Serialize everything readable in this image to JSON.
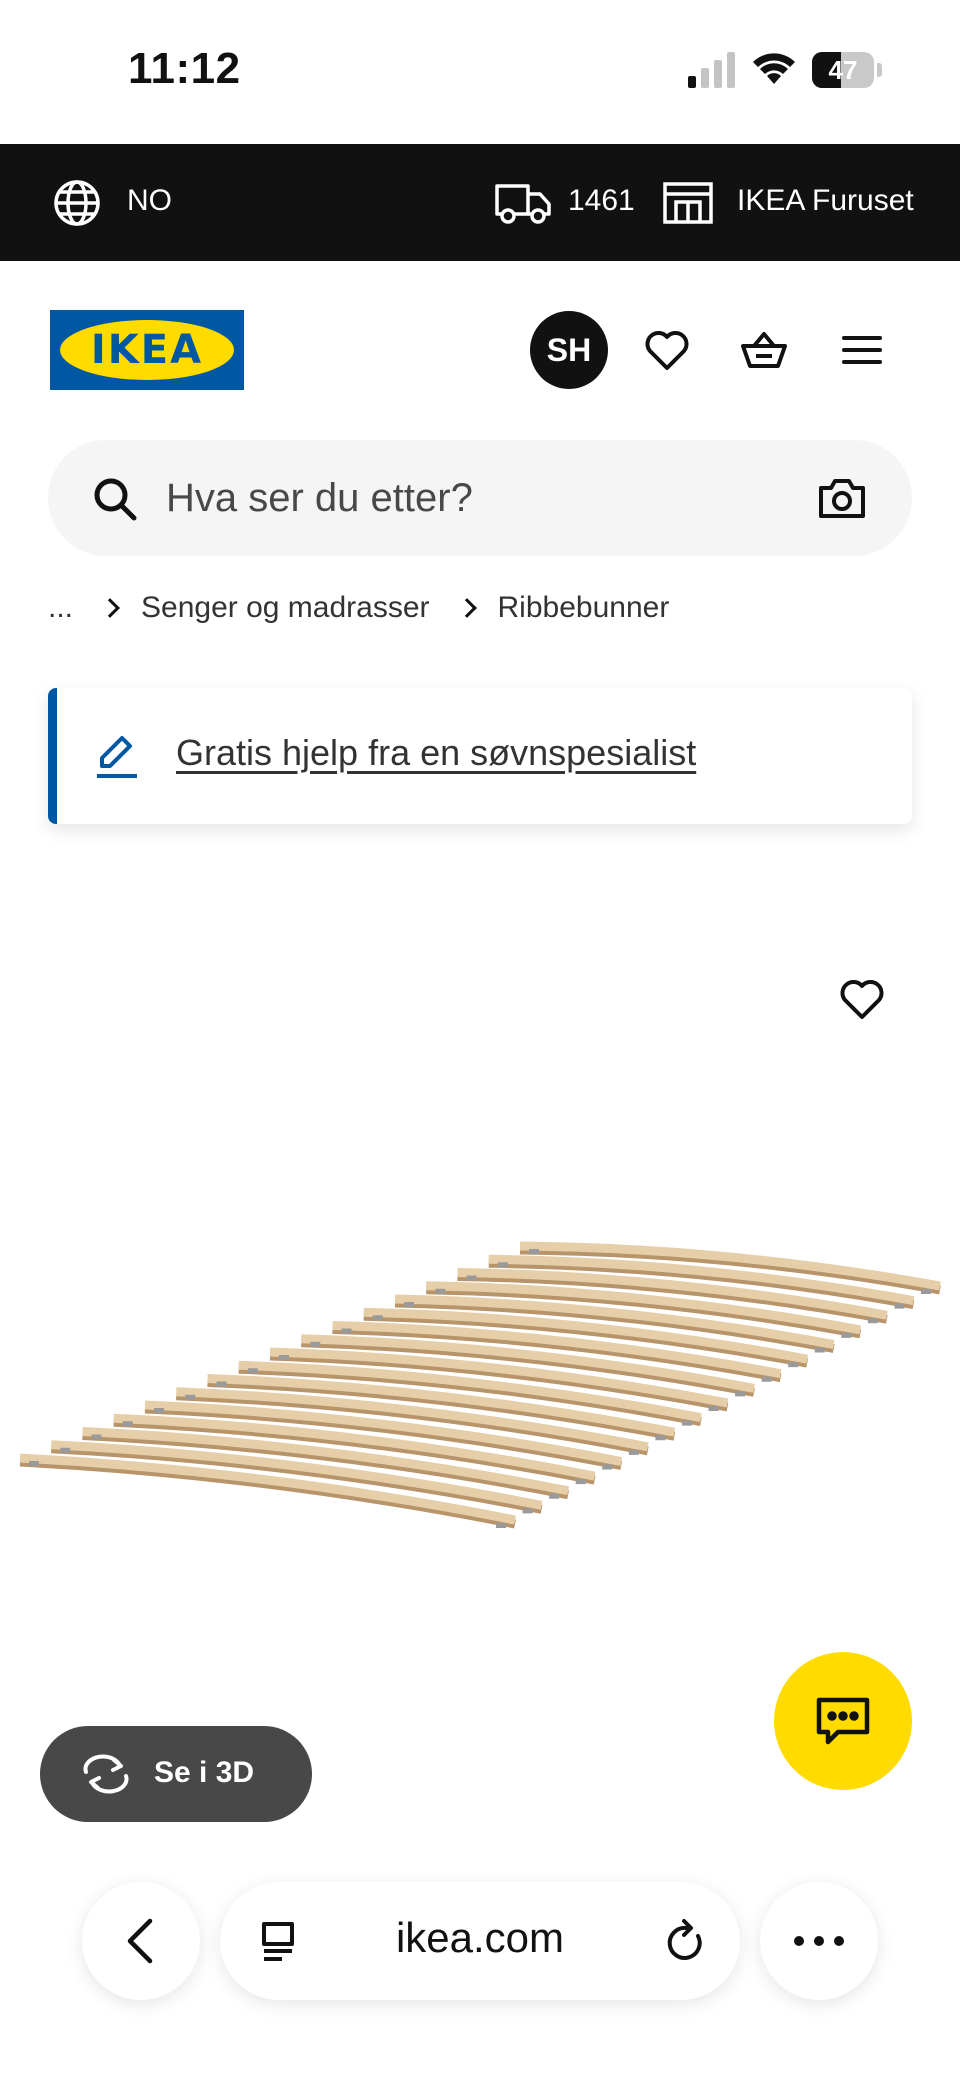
{
  "status_bar": {
    "time": "11:12",
    "battery": "47",
    "battery_fraction": 0.47
  },
  "top_bar": {
    "country": "NO",
    "postcode": "1461",
    "store": "IKEA Furuset"
  },
  "header": {
    "logo_text": "IKEA",
    "avatar_initials": "SH"
  },
  "search": {
    "placeholder": "Hva ser du etter?"
  },
  "breadcrumb": {
    "ellipsis": "...",
    "items": [
      "Senger og madrasser",
      "Ribbebunner"
    ]
  },
  "help_banner": {
    "link_text": "Gratis hjelp fra en søvnspesialist"
  },
  "product": {
    "see_3d_label": "Se i 3D"
  },
  "browser": {
    "url": "ikea.com"
  },
  "colors": {
    "ikea_blue": "#0058a3",
    "ikea_yellow": "#ffdb00",
    "top_bar": "#111111"
  }
}
